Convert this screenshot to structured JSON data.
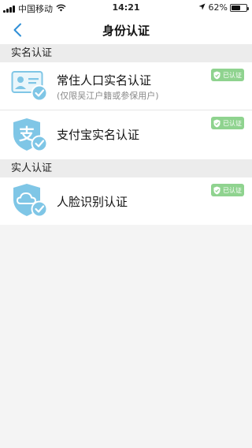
{
  "status_bar": {
    "carrier": "中国移动",
    "time": "14:21",
    "battery": "62%",
    "battery_level": 0.62
  },
  "nav": {
    "title": "身份认证"
  },
  "sections": [
    {
      "header": "实名认证",
      "items": [
        {
          "title": "常住人口实名认证",
          "subtitle": "(仅限吴江户籍或参保用户)",
          "badge": "已认证"
        },
        {
          "title": "支付宝实名认证",
          "badge": "已认证"
        }
      ]
    },
    {
      "header": "实人认证",
      "items": [
        {
          "title": "人脸识别认证",
          "badge": "已认证"
        }
      ]
    }
  ],
  "colors": {
    "accent_blue": "#2f8fd6",
    "badge_green": "#8fd38f",
    "icon_light_blue": "#7fc6e6"
  }
}
